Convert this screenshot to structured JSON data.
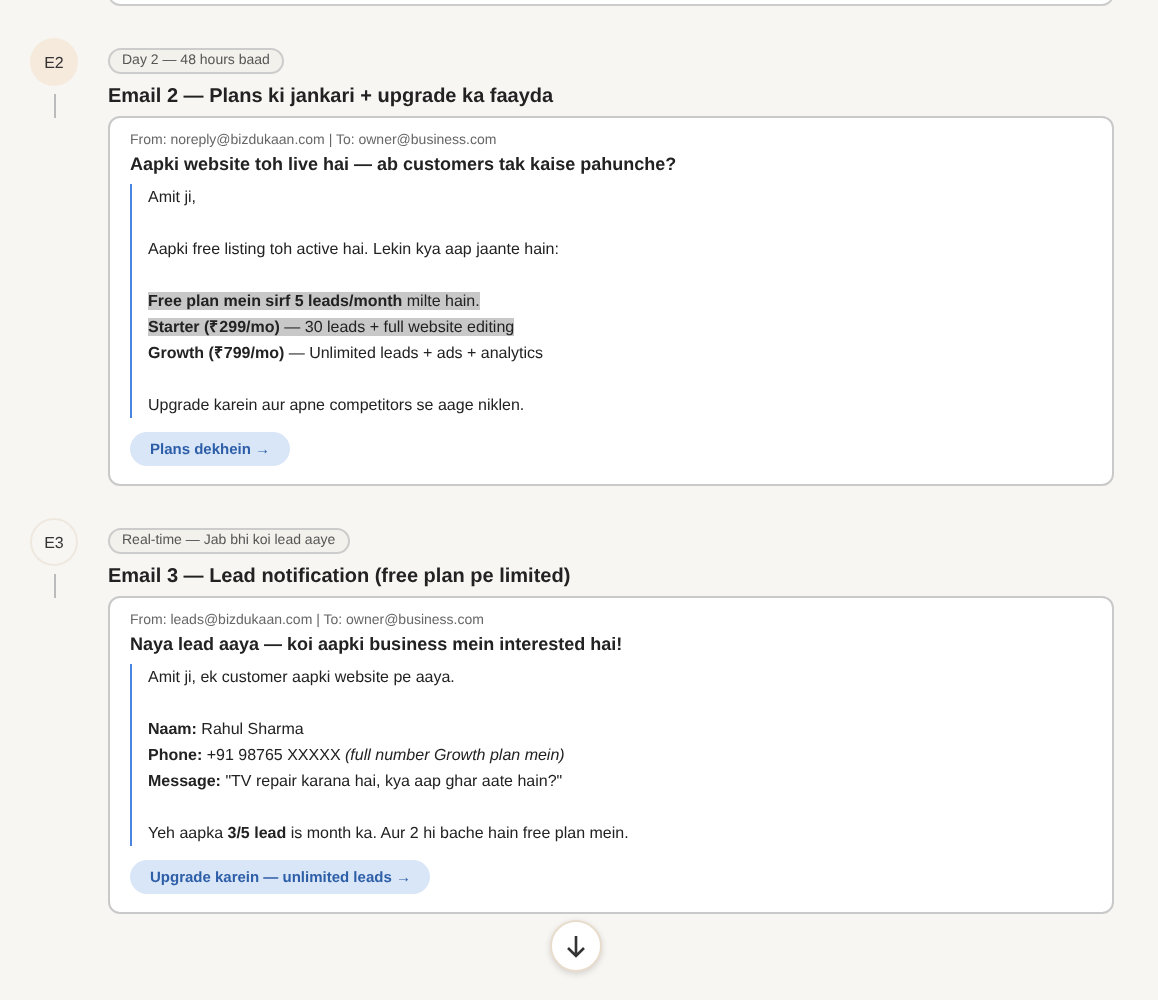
{
  "emails": [
    {
      "step": "E2",
      "active": true,
      "timing": "Day 2 — 48 hours baad",
      "title": "Email 2 — Plans ki jankari + upgrade ka faayda",
      "meta": "From: noreply@bizdukaan.com | To: owner@business.com",
      "subject": "Aapki website toh live hai — ab customers tak kaise pahunche?",
      "paragraphs": [
        [
          {
            "text": "Amit ji,",
            "highlighted": false
          }
        ],
        [
          {
            "text": "Aapki free listing toh active hai. Lekin kya aap jaante hain:",
            "highlighted": false
          }
        ],
        [
          {
            "text": "**Free plan mein sirf 5 leads/month** milte hain.",
            "highlighted": true
          },
          {
            "text": "**Starter (₹299/mo)** — 30 leads + full website editing",
            "highlighted": true
          },
          {
            "text": "**Growth (₹799/mo)** — Unlimited leads + ads + analytics",
            "highlighted": false
          }
        ],
        [
          {
            "text": "Upgrade karein aur apne competitors se aage niklen.",
            "highlighted": false
          }
        ]
      ],
      "cta": "Plans dekhein →"
    },
    {
      "step": "E3",
      "active": false,
      "timing": "Real-time — Jab bhi koi lead aaye",
      "title": "Email 3 — Lead notification (free plan pe limited)",
      "meta": "From: leads@bizdukaan.com | To: owner@business.com",
      "subject": "Naya lead aaya — koi aapki business mein interested hai!",
      "paragraphs": [
        [
          {
            "text": "Amit ji, ek customer aapki website pe aaya.",
            "highlighted": false
          }
        ],
        [
          {
            "text": "**Naam:** Rahul Sharma",
            "highlighted": false
          },
          {
            "text": "**Phone:** +91 98765 XXXXX  *(full number Growth plan mein)*",
            "highlighted": false
          },
          {
            "text": "**Message:** \"TV repair karana hai, kya aap ghar aate hain?\"",
            "highlighted": false
          }
        ],
        [
          {
            "text": "Yeh aapka **3/5 lead** is month ka. Aur 2 hi bache hain free plan mein.",
            "highlighted": false
          }
        ]
      ],
      "cta": "Upgrade karein — unlimited leads →"
    }
  ]
}
